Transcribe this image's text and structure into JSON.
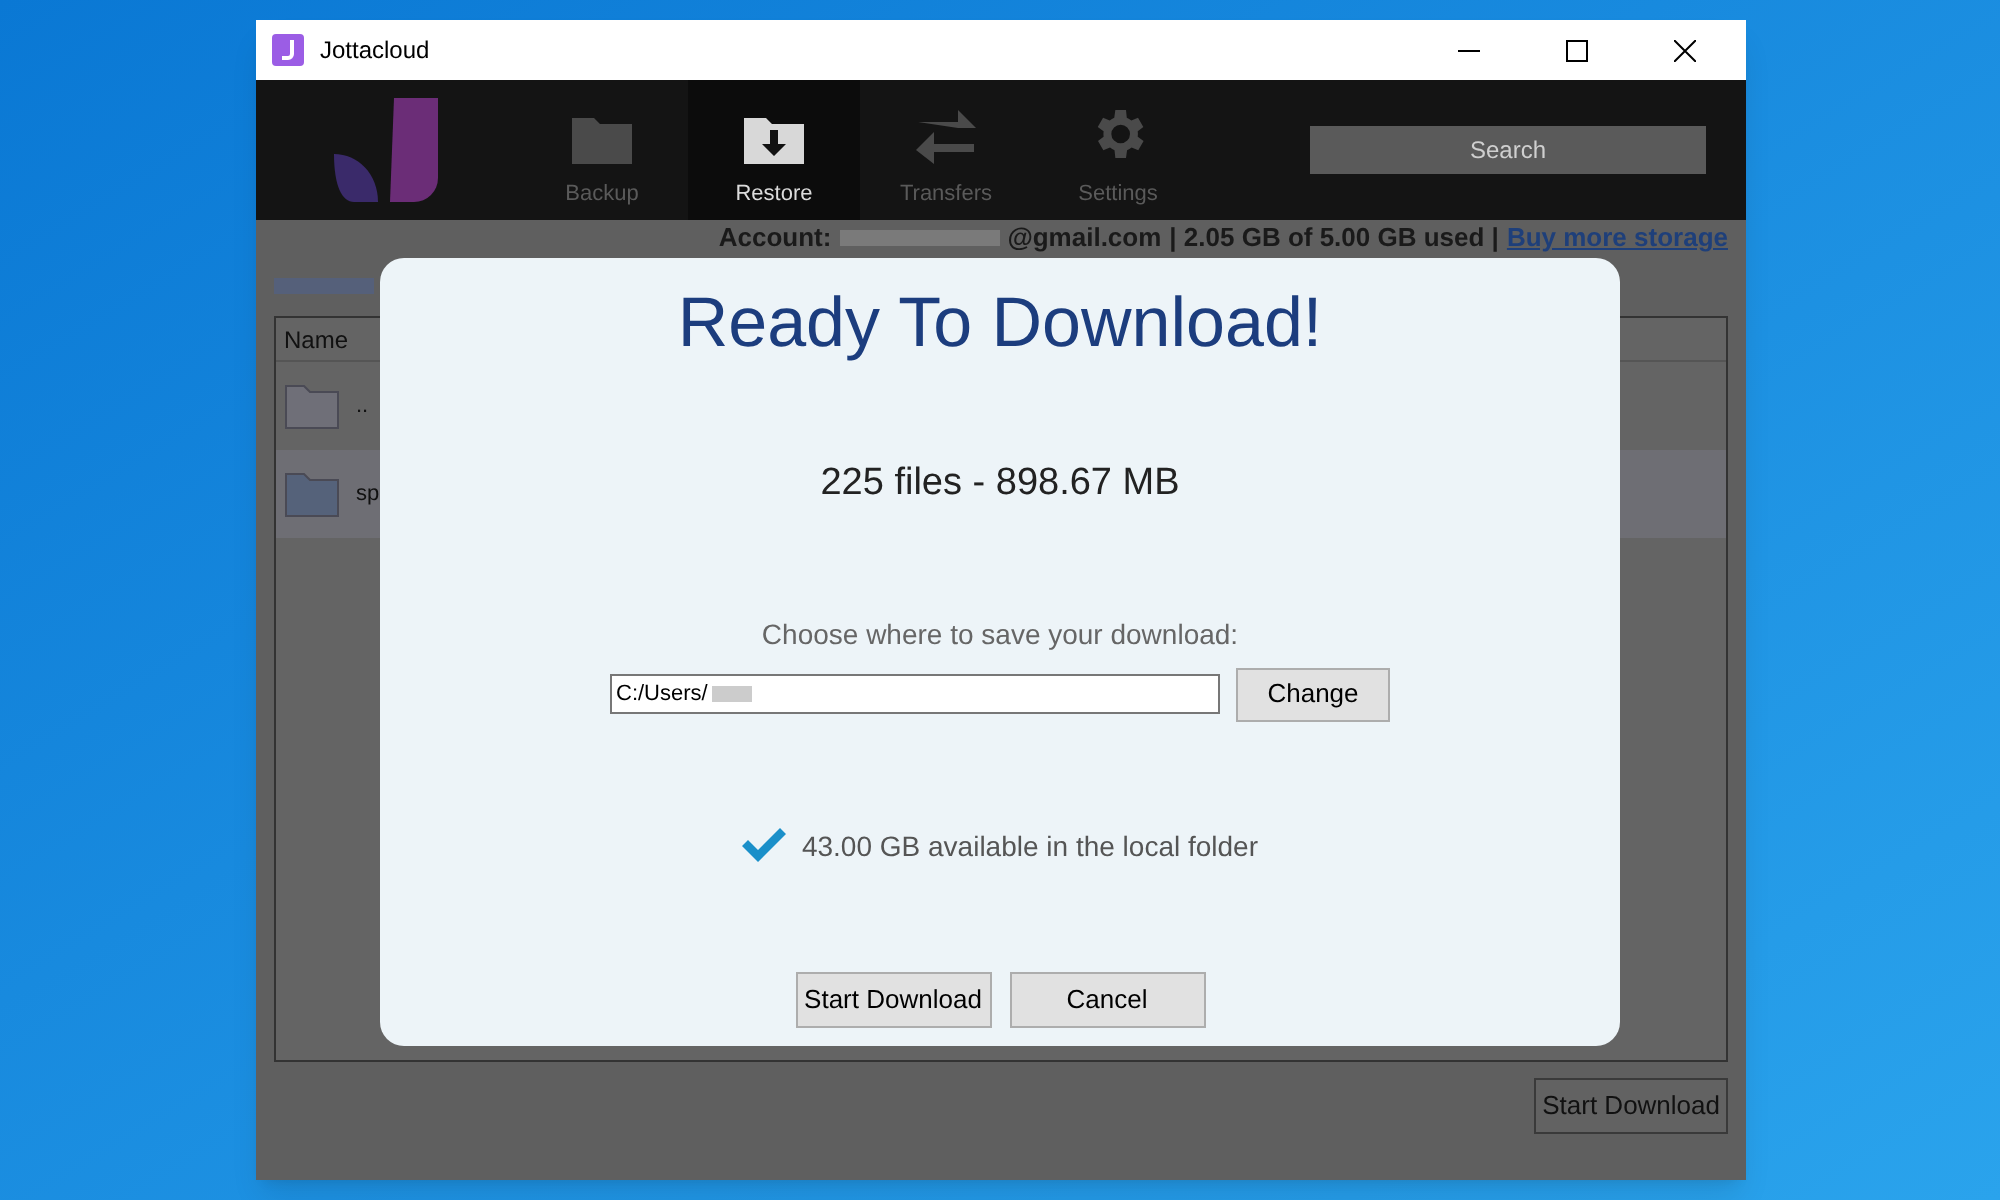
{
  "window": {
    "title": "Jottacloud"
  },
  "toolbar": {
    "tabs": [
      {
        "label": "Backup",
        "selected": false
      },
      {
        "label": "Restore",
        "selected": true
      },
      {
        "label": "Transfers",
        "selected": false
      },
      {
        "label": "Settings",
        "selected": false
      }
    ],
    "search": {
      "placeholder": "Search"
    }
  },
  "account": {
    "label": "Account:",
    "email_suffix": "@gmail.com",
    "usage": "| 2.05 GB of 5.00 GB used |",
    "link": "Buy more storage"
  },
  "file_list": {
    "columns": [
      "Name"
    ],
    "rows": [
      {
        "name": "..",
        "selected": false
      },
      {
        "name": "sp",
        "selected": true
      }
    ]
  },
  "bottom_button": "Start Download",
  "dialog": {
    "title": "Ready To Download!",
    "summary": "225 files - 898.67 MB",
    "prompt": "Choose where to save your download:",
    "path": "C:/Users/",
    "change_button": "Change",
    "space_note": "43.00 GB available in the local folder",
    "buttons": [
      "Start Download",
      "Cancel"
    ]
  }
}
